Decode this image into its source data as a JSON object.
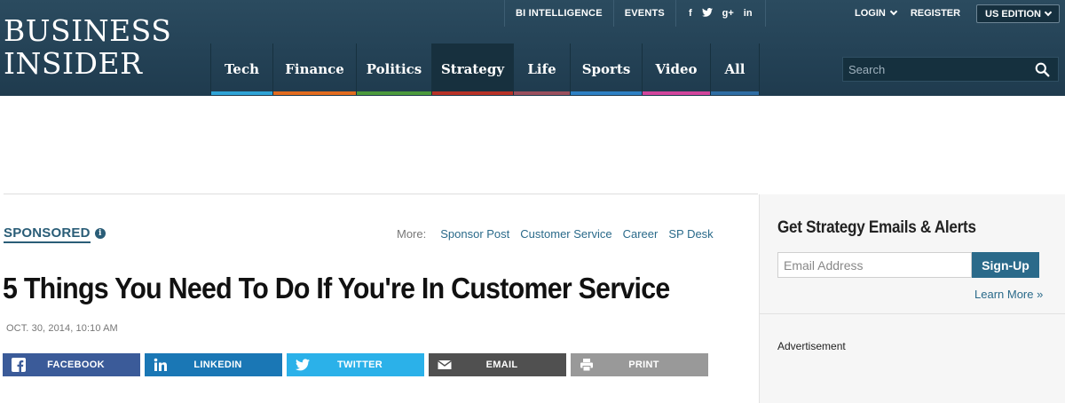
{
  "logo": {
    "line1": "BUSINESS",
    "line2": "INSIDER"
  },
  "utility": {
    "bi_intelligence": "BI INTELLIGENCE",
    "events": "EVENTS",
    "social": {
      "facebook": "f",
      "twitter": "t",
      "googleplus": "g+",
      "linkedin": "in"
    }
  },
  "account": {
    "login": "LOGIN",
    "register": "REGISTER",
    "edition": "US EDITION"
  },
  "nav": {
    "items": [
      {
        "label": "Tech",
        "color": "#2ea3d6"
      },
      {
        "label": "Finance",
        "color": "#e26b1f"
      },
      {
        "label": "Politics",
        "color": "#4b9a3c"
      },
      {
        "label": "Strategy",
        "color": "#b83227"
      },
      {
        "label": "Life",
        "color": "#9a4f5d"
      },
      {
        "label": "Sports",
        "color": "#2d80c4"
      },
      {
        "label": "Video",
        "color": "#d1459c"
      },
      {
        "label": "All",
        "color": "#2e6da4"
      }
    ],
    "active_index": 3
  },
  "search": {
    "placeholder": "Search"
  },
  "article": {
    "sponsored_label": "SPONSORED",
    "more_label": "More:",
    "more_links": [
      "Sponsor Post",
      "Customer Service",
      "Career",
      "SP Desk"
    ],
    "headline": "5 Things You Need To Do If You're In Customer Service",
    "timestamp": "OCT. 30, 2014, 10:10 AM"
  },
  "share": {
    "buttons": [
      {
        "label": "FACEBOOK",
        "icon": "facebook-icon",
        "color": "#3b5b99"
      },
      {
        "label": "LINKEDIN",
        "icon": "linkedin-icon",
        "color": "#1a77b5"
      },
      {
        "label": "TWITTER",
        "icon": "twitter-icon",
        "color": "#2bb1e9"
      },
      {
        "label": "EMAIL",
        "icon": "email-icon",
        "color": "#505050"
      },
      {
        "label": "PRINT",
        "icon": "print-icon",
        "color": "#999999"
      }
    ]
  },
  "sidebar": {
    "title": "Get Strategy Emails & Alerts",
    "email_placeholder": "Email Address",
    "signup_label": "Sign-Up",
    "learn_more": "Learn More »",
    "advertisement": "Advertisement"
  }
}
